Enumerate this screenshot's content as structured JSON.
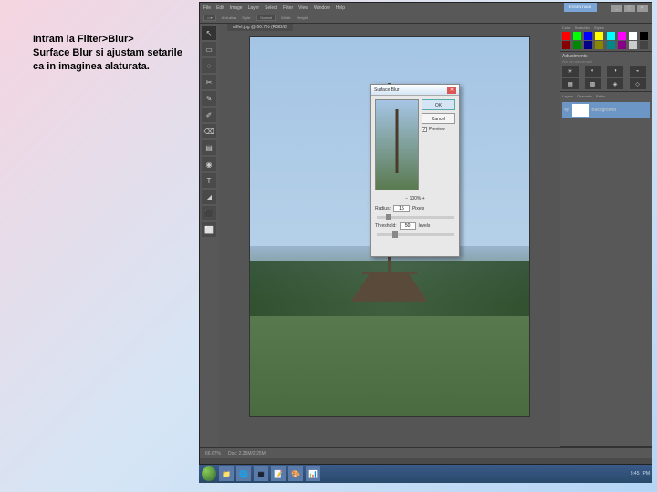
{
  "instruction": {
    "line1": "Intram la Filter>Blur>",
    "line2": "Surface Blur si ajustam setarile ca in imaginea alaturata."
  },
  "menubar": {
    "items": [
      "File",
      "Edit",
      "Image",
      "Layer",
      "Select",
      "Filter",
      "View",
      "Window",
      "Help"
    ],
    "workspace_switcher": "ESSENTIALS"
  },
  "options_bar": {
    "items": [
      "Anti-alias",
      "Style:",
      "Normal",
      "Width:",
      "Height:"
    ]
  },
  "tools": [
    "↖",
    "▭",
    "◌",
    "✂",
    "✎",
    "✐",
    "⌫",
    "▤",
    "◉",
    "T",
    "◢",
    "⬛",
    "⬜"
  ],
  "doc_tab": "eiffel.jpg @ 66.7% (RGB/8)",
  "panels": {
    "color_tabs": [
      "Color",
      "Swatches",
      "Styles"
    ],
    "swatch_colors": [
      "#f00",
      "#0f0",
      "#00f",
      "#ff0",
      "#0ff",
      "#f0f",
      "#fff",
      "#000",
      "#800",
      "#080",
      "#008",
      "#880",
      "#088",
      "#808",
      "#ccc",
      "#444"
    ],
    "adjustments_title": "Adjustments",
    "adjustments_hint": "Add an adjustment",
    "adjustment_icons": [
      "☀",
      "◐",
      "◑",
      "◒",
      "▦",
      "▩",
      "◈",
      "◇"
    ],
    "layers_tabs": [
      "Layers",
      "Channels",
      "Paths"
    ],
    "layer_name": "Background"
  },
  "dialog": {
    "title": "Surface Blur",
    "ok": "OK",
    "cancel": "Cancel",
    "preview": "Preview",
    "radius_label": "Radius:",
    "radius_value": "15",
    "radius_unit": "Pixels",
    "threshold_label": "Threshold:",
    "threshold_value": "50",
    "threshold_unit": "levels",
    "zoom": "100%"
  },
  "statusbar": {
    "zoom": "66.67%",
    "doc": "Doc: 2.25M/2.25M"
  },
  "taskbar": {
    "icons": [
      "📁",
      "🌐",
      "▦",
      "📝",
      "🎨",
      "📊"
    ],
    "time": "8:45",
    "date": "PM"
  }
}
